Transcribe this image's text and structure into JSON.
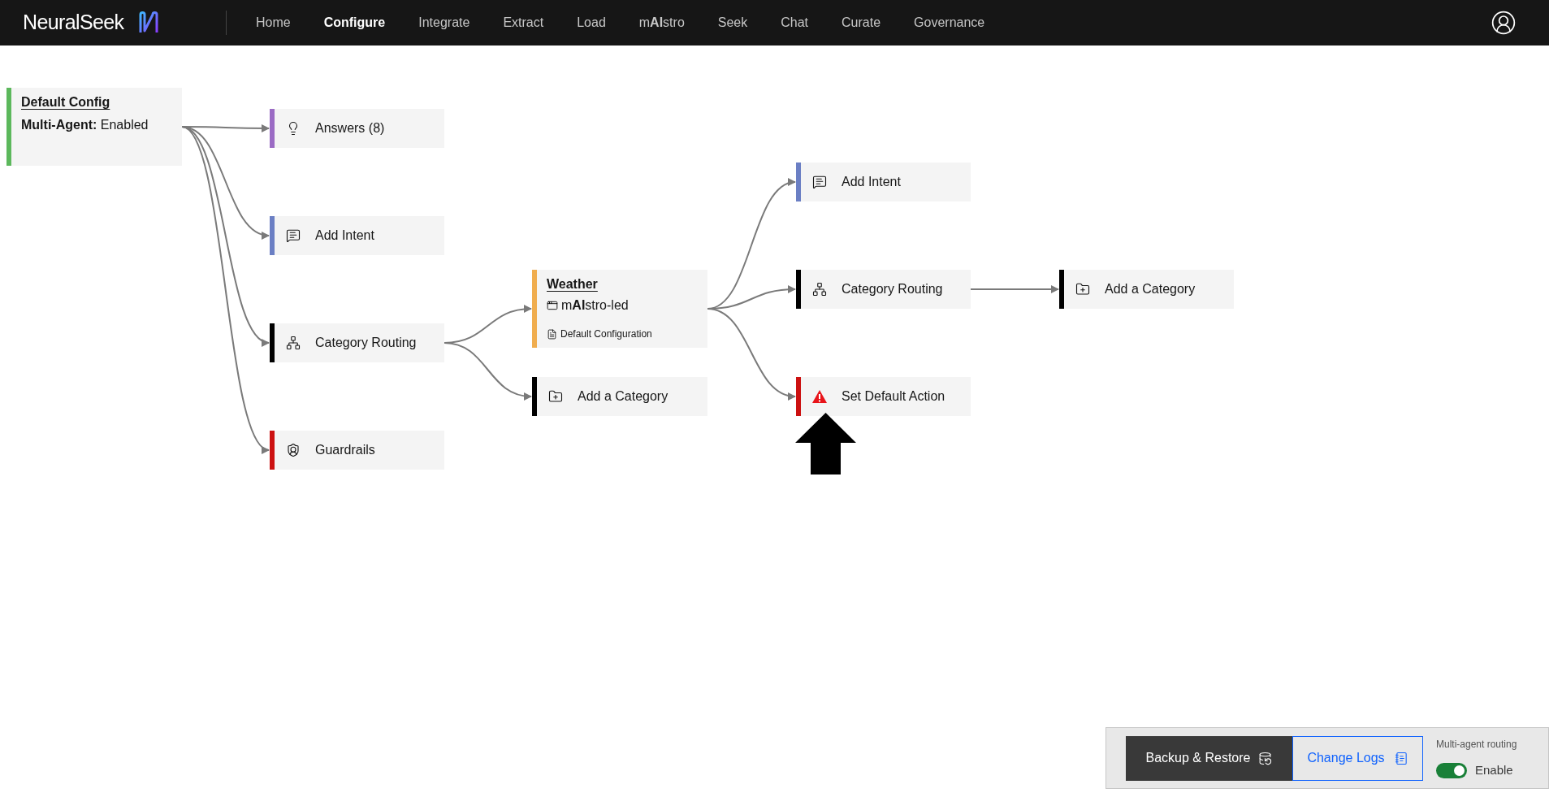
{
  "header": {
    "logo": "**Neural**Seek",
    "nav": [
      {
        "label": "Home",
        "selected": false
      },
      {
        "label": "Configure",
        "selected": true
      },
      {
        "label": "Integrate",
        "selected": false
      },
      {
        "label": "Extract",
        "selected": false
      },
      {
        "label": "Load",
        "selected": false
      },
      {
        "label": "m**AI**stro",
        "selected": false
      },
      {
        "label": "Seek",
        "selected": false
      },
      {
        "label": "Chat",
        "selected": false
      },
      {
        "label": "Curate",
        "selected": false
      },
      {
        "label": "Governance",
        "selected": false
      }
    ]
  },
  "nodes": [
    {
      "kind": "config",
      "title": "Default Config",
      "detail": "**Multi-Agent:** Enabled",
      "color": "#5cb85c"
    },
    {
      "kind": "answers",
      "label": "Answers (8)",
      "color": "#9b6bc4"
    },
    {
      "kind": "intent",
      "label": "Add Intent",
      "color": "#6b7fc4"
    },
    {
      "kind": "routing",
      "label": "Category Routing",
      "color": "#000000"
    },
    {
      "kind": "guardrails",
      "label": "Guardrails",
      "color": "#cc1111"
    },
    {
      "kind": "category",
      "title": "Weather",
      "detail": "m**AI**stro-led",
      "note": "Default Configuration",
      "color": "#f0ad4e"
    },
    {
      "kind": "add-category",
      "label": "Add a Category",
      "color": "#000000"
    },
    {
      "kind": "intent",
      "label": "Add Intent",
      "color": "#6b7fc4"
    },
    {
      "kind": "routing",
      "label": "Category Routing",
      "color": "#000000"
    },
    {
      "kind": "warning",
      "label": "Set Default Action",
      "color": "#cc1111"
    },
    {
      "kind": "add-category",
      "label": "Add a Category",
      "color": "#000000"
    }
  ],
  "footer": {
    "buttons": [
      {
        "kind": "primary",
        "label": "Backup & Restore"
      },
      {
        "kind": "secondary",
        "label": "Change Logs"
      }
    ],
    "toggle": {
      "title": "Multi-agent routing",
      "label": "Enable",
      "on": true
    }
  }
}
